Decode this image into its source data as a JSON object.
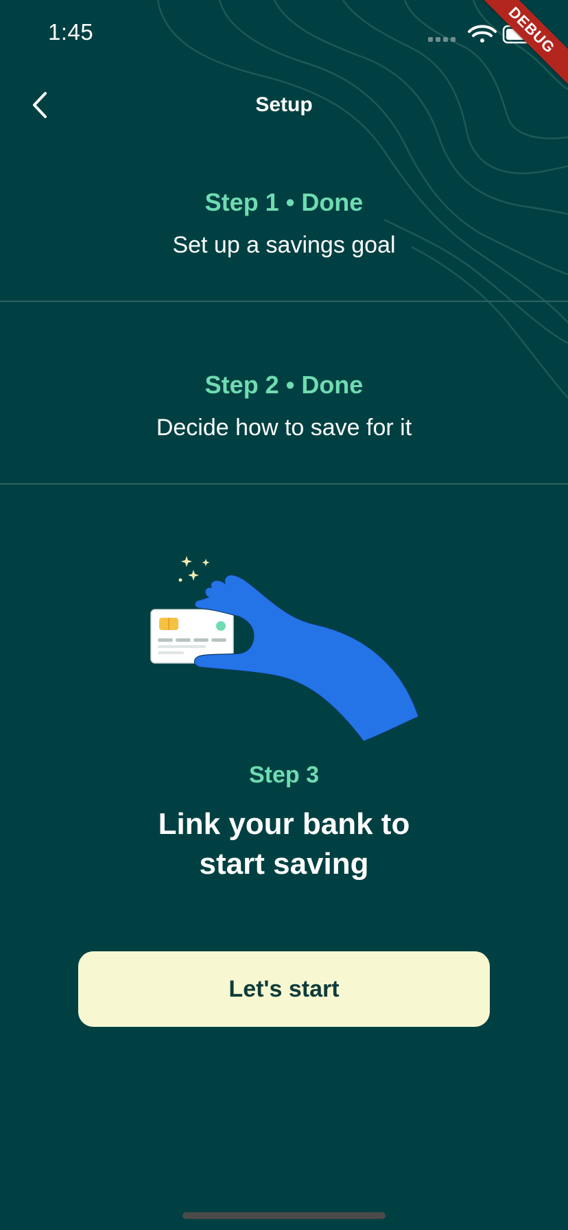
{
  "status_bar": {
    "time": "1:45",
    "icons": [
      "signal-icon",
      "wifi-icon",
      "battery-icon"
    ]
  },
  "debug_banner": "DEBUG",
  "nav": {
    "back_icon": "chevron-left-icon",
    "title": "Setup"
  },
  "steps": [
    {
      "title": "Step 1 • Done",
      "subtitle": "Set up a savings goal"
    },
    {
      "title": "Step 2 • Done",
      "subtitle": "Decide how to save for it"
    }
  ],
  "step3": {
    "label": "Step 3",
    "heading_line1": "Link your bank to",
    "heading_line2": "start saving",
    "illustration": "hand-holding-card-illustration"
  },
  "cta": {
    "label": "Let's start"
  },
  "colors": {
    "background": "#014042",
    "accent_green": "#6fdcb1",
    "button_bg": "#f7f8d2",
    "button_text": "#0f3c3a",
    "hand_blue": "#2474e8"
  }
}
